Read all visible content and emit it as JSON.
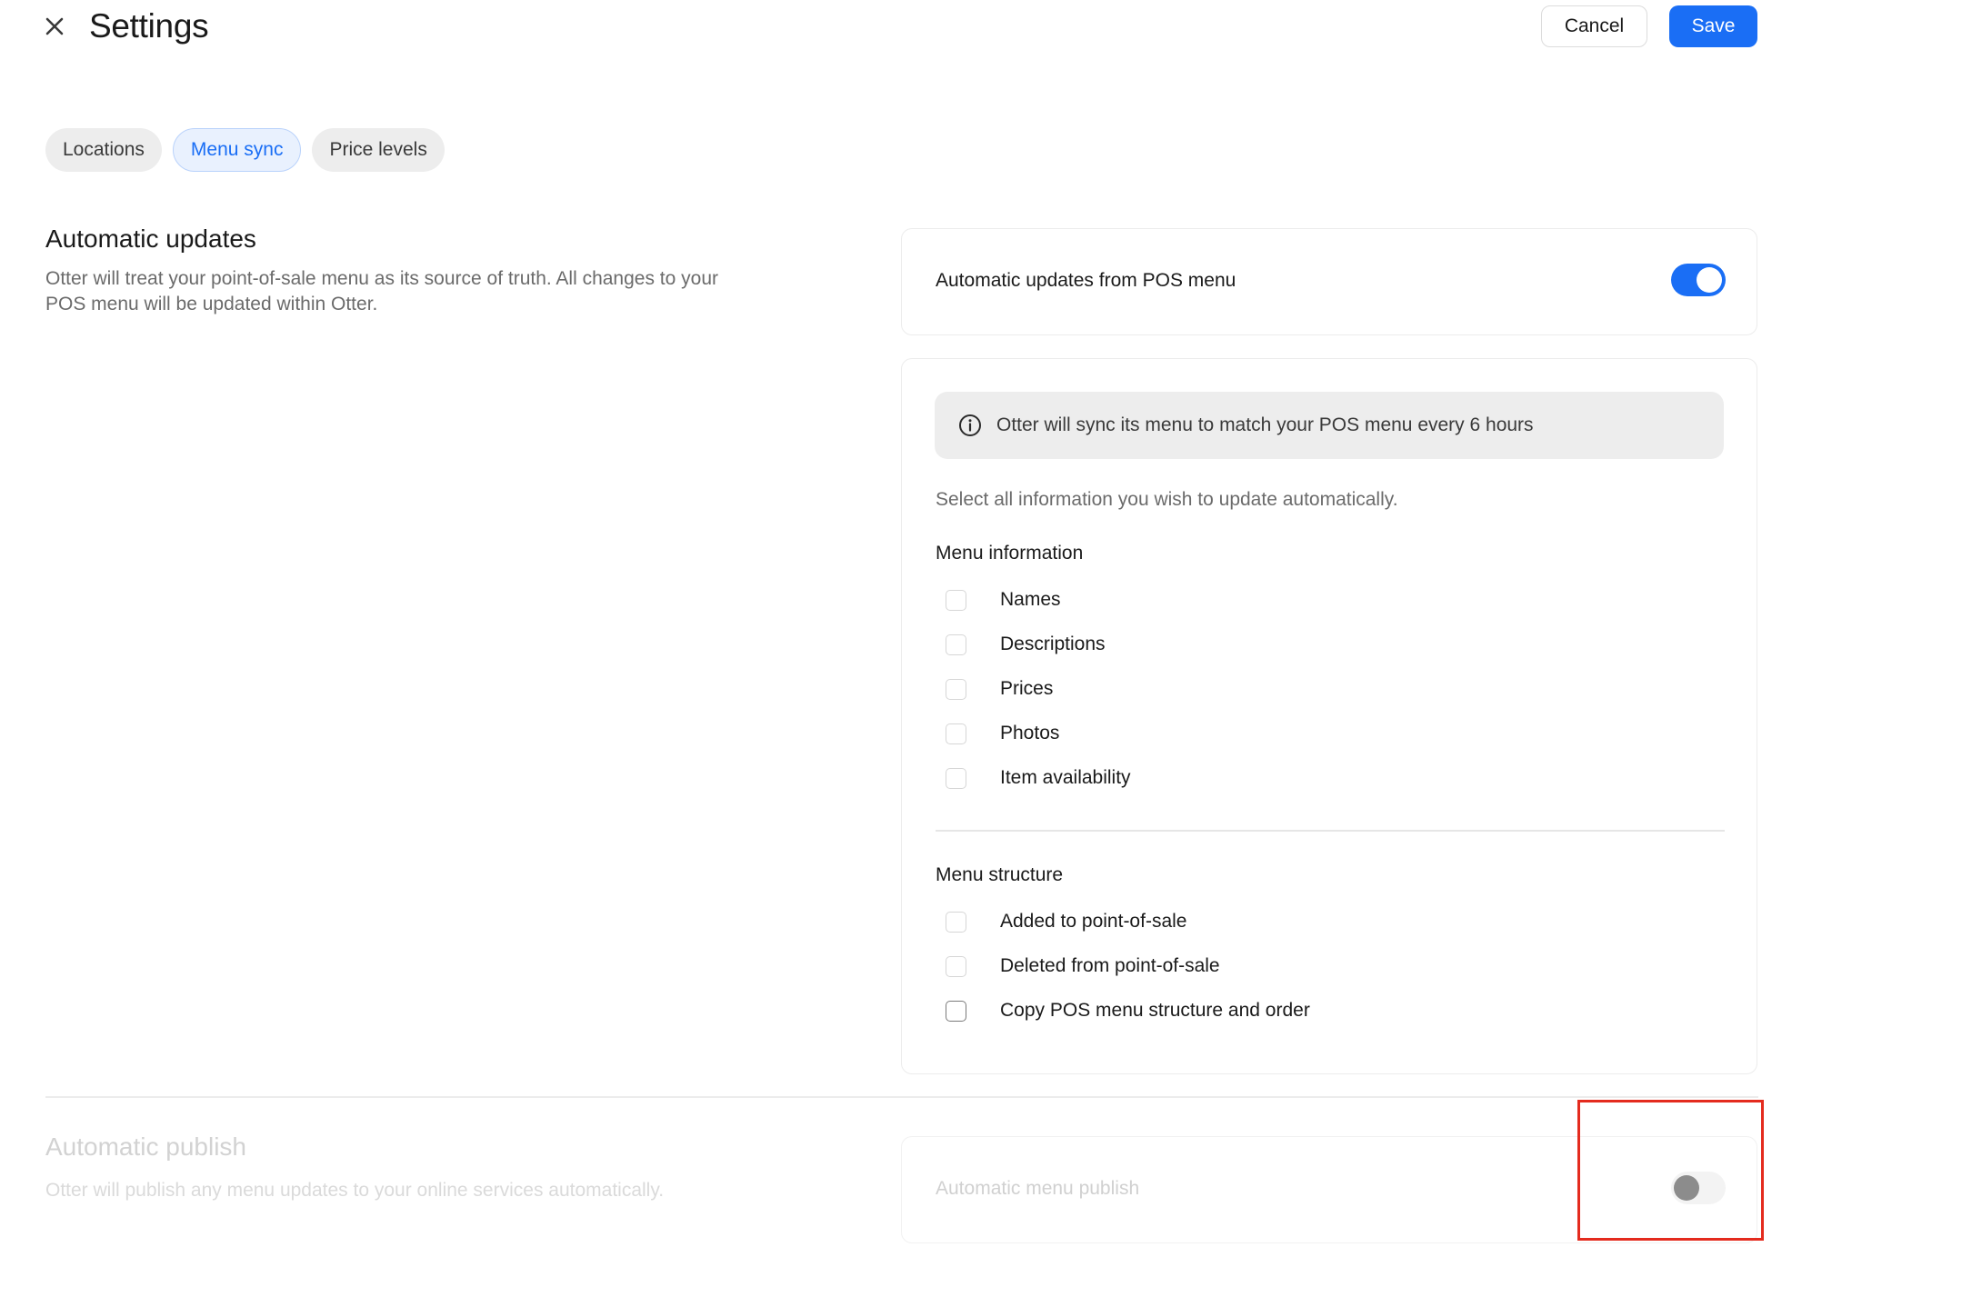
{
  "header": {
    "title": "Settings",
    "cancel_label": "Cancel",
    "save_label": "Save"
  },
  "tabs": [
    {
      "label": "Locations",
      "active": false
    },
    {
      "label": "Menu sync",
      "active": true
    },
    {
      "label": "Price levels",
      "active": false
    }
  ],
  "automatic_updates": {
    "title": "Automatic updates",
    "description": "Otter will treat your point-of-sale menu as its source of truth. All changes to your POS menu will be updated within Otter.",
    "toggle_label": "Automatic updates from POS menu",
    "toggle_on": true,
    "info_banner": "Otter will sync its menu to match your POS menu every 6 hours",
    "helper_text": "Select all information you wish to update automatically.",
    "menu_information": {
      "heading": "Menu information",
      "items": [
        "Names",
        "Descriptions",
        "Prices",
        "Photos",
        "Item availability"
      ]
    },
    "menu_structure": {
      "heading": "Menu structure",
      "items": [
        "Added to point-of-sale",
        "Deleted from point-of-sale",
        "Copy POS menu structure and order"
      ]
    }
  },
  "automatic_publish": {
    "title": "Automatic publish",
    "description": "Otter will publish any menu updates to your online services automatically.",
    "toggle_label": "Automatic menu publish",
    "toggle_on": false
  },
  "colors": {
    "accent": "#1a6ef5",
    "highlight": "#e42b1e"
  },
  "icons": {
    "close": "close-icon",
    "info": "info-icon"
  }
}
